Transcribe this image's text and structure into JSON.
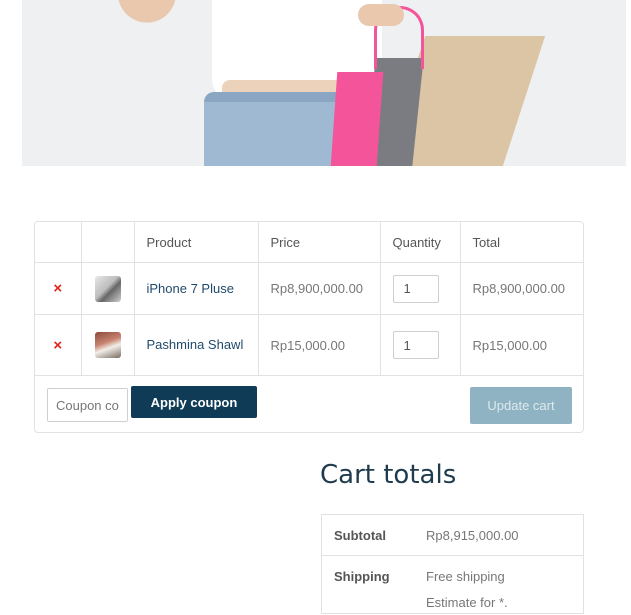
{
  "cart": {
    "headers": {
      "remove": "",
      "thumbnail": "",
      "product": "Product",
      "price": "Price",
      "quantity": "Quantity",
      "total": "Total"
    },
    "items": [
      {
        "remove_icon": "×",
        "thumbnail_icon": "iphone-thumbnail",
        "name": "iPhone 7 Pluse",
        "price": "Rp8,900,000.00",
        "quantity": "1",
        "total": "Rp8,900,000.00"
      },
      {
        "remove_icon": "×",
        "thumbnail_icon": "shawl-thumbnail",
        "name": "Pashmina Shawl",
        "price": "Rp15,000.00",
        "quantity": "1",
        "total": "Rp15,000.00"
      }
    ],
    "actions": {
      "coupon_placeholder": "Coupon code",
      "apply_label": "Apply coupon",
      "update_label": "Update cart"
    }
  },
  "totals": {
    "title": "Cart totals",
    "subtotal_label": "Subtotal",
    "subtotal_value": "Rp8,915,000.00",
    "shipping_label": "Shipping",
    "shipping_value": "Free shipping",
    "shipping_note": "Estimate for *."
  },
  "colors": {
    "remove": "#e2231a",
    "primary_button": "#0f3b56",
    "disabled_button": "#8fb3c2",
    "link": "#1f4a6b"
  }
}
